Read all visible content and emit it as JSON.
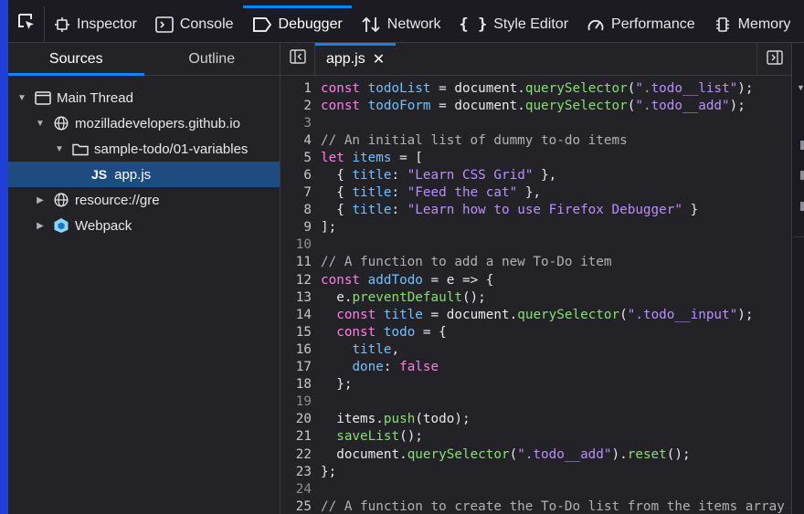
{
  "toolbar": {
    "tabs": [
      {
        "label": "Inspector",
        "icon": "inspector-icon"
      },
      {
        "label": "Console",
        "icon": "console-icon"
      },
      {
        "label": "Debugger",
        "icon": "debugger-icon",
        "active": true
      },
      {
        "label": "Network",
        "icon": "network-icon"
      },
      {
        "label": "Style Editor",
        "icon": "style-editor-icon"
      },
      {
        "label": "Performance",
        "icon": "performance-icon"
      },
      {
        "label": "Memory",
        "icon": "memory-icon"
      }
    ],
    "accent": "#0a84ff"
  },
  "sources": {
    "tabs": [
      "Sources",
      "Outline"
    ],
    "tree": [
      {
        "label": "Main Thread",
        "icon": "window-icon",
        "expanded": true
      },
      {
        "label": "mozilladevelopers.github.io",
        "icon": "globe-icon",
        "expanded": true
      },
      {
        "label": "sample-todo/01-variables",
        "icon": "folder-icon",
        "expanded": true
      },
      {
        "label": "app.js",
        "badge": "JS",
        "selected": true
      },
      {
        "label": "resource://gre",
        "icon": "globe-icon",
        "expanded": false
      },
      {
        "label": "Webpack",
        "icon": "webpack-icon",
        "expanded": false
      }
    ]
  },
  "editor": {
    "file_tab": "app.js",
    "close_glyph": "✕",
    "lines": [
      {
        "n": "1",
        "t": "const todoList = document.querySelector(\".todo__list\");"
      },
      {
        "n": "2",
        "t": "const todoForm = document.querySelector(\".todo__add\");"
      },
      {
        "n": "3",
        "t": ""
      },
      {
        "n": "4",
        "t": "// An initial list of dummy to-do items"
      },
      {
        "n": "5",
        "t": "let items = ["
      },
      {
        "n": "6",
        "t": "  { title: \"Learn CSS Grid\" },"
      },
      {
        "n": "7",
        "t": "  { title: \"Feed the cat\" },"
      },
      {
        "n": "8",
        "t": "  { title: \"Learn how to use Firefox Debugger\" }"
      },
      {
        "n": "9",
        "t": "];"
      },
      {
        "n": "10",
        "t": ""
      },
      {
        "n": "11",
        "t": "// A function to add a new To-Do item"
      },
      {
        "n": "12",
        "t": "const addTodo = e => {"
      },
      {
        "n": "13",
        "t": "  e.preventDefault();"
      },
      {
        "n": "14",
        "t": "  const title = document.querySelector(\".todo__input\");"
      },
      {
        "n": "15",
        "t": "  const todo = {"
      },
      {
        "n": "16",
        "t": "    title,"
      },
      {
        "n": "17",
        "t": "    done: false"
      },
      {
        "n": "18",
        "t": "  };"
      },
      {
        "n": "19",
        "t": ""
      },
      {
        "n": "20",
        "t": "  items.push(todo);"
      },
      {
        "n": "21",
        "t": "  saveList();"
      },
      {
        "n": "22",
        "t": "  document.querySelector(\".todo__add\").reset();"
      },
      {
        "n": "23",
        "t": "};"
      },
      {
        "n": "24",
        "t": ""
      },
      {
        "n": "25",
        "t": "// A function to create the To-Do list from the items array"
      }
    ]
  }
}
